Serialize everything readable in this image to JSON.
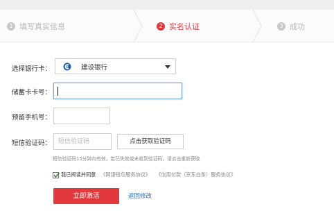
{
  "steps": [
    {
      "number": "1",
      "label": "填写真实信息"
    },
    {
      "number": "2",
      "label": "实名认证"
    },
    {
      "number": "3",
      "label": "成功"
    }
  ],
  "form": {
    "bank_label": "选择银行卡：",
    "bank_value": "建设银行",
    "card_label": "储蓄卡卡号：",
    "card_value": "",
    "phone_label": "预留手机号：",
    "phone_value": "",
    "code_label": "短信验证码：",
    "code_placeholder": "短信验证码",
    "get_code_button": "点击获取验证码",
    "hint": "短信验证码15分钟内有效，若已失效或未收到验证码，请点击重新获取"
  },
  "agreement": {
    "checked": true,
    "text": "我已阅读并同意",
    "protocols": [
      "《网银钱包服务协议》",
      "《信用付款（京东白条）服务协议》"
    ]
  },
  "actions": {
    "submit": "立即激活",
    "back": "返回修改"
  },
  "colors": {
    "accent": "#e4393c",
    "link": "#2a6ebd",
    "bank_logo": "#1a5fb4"
  }
}
